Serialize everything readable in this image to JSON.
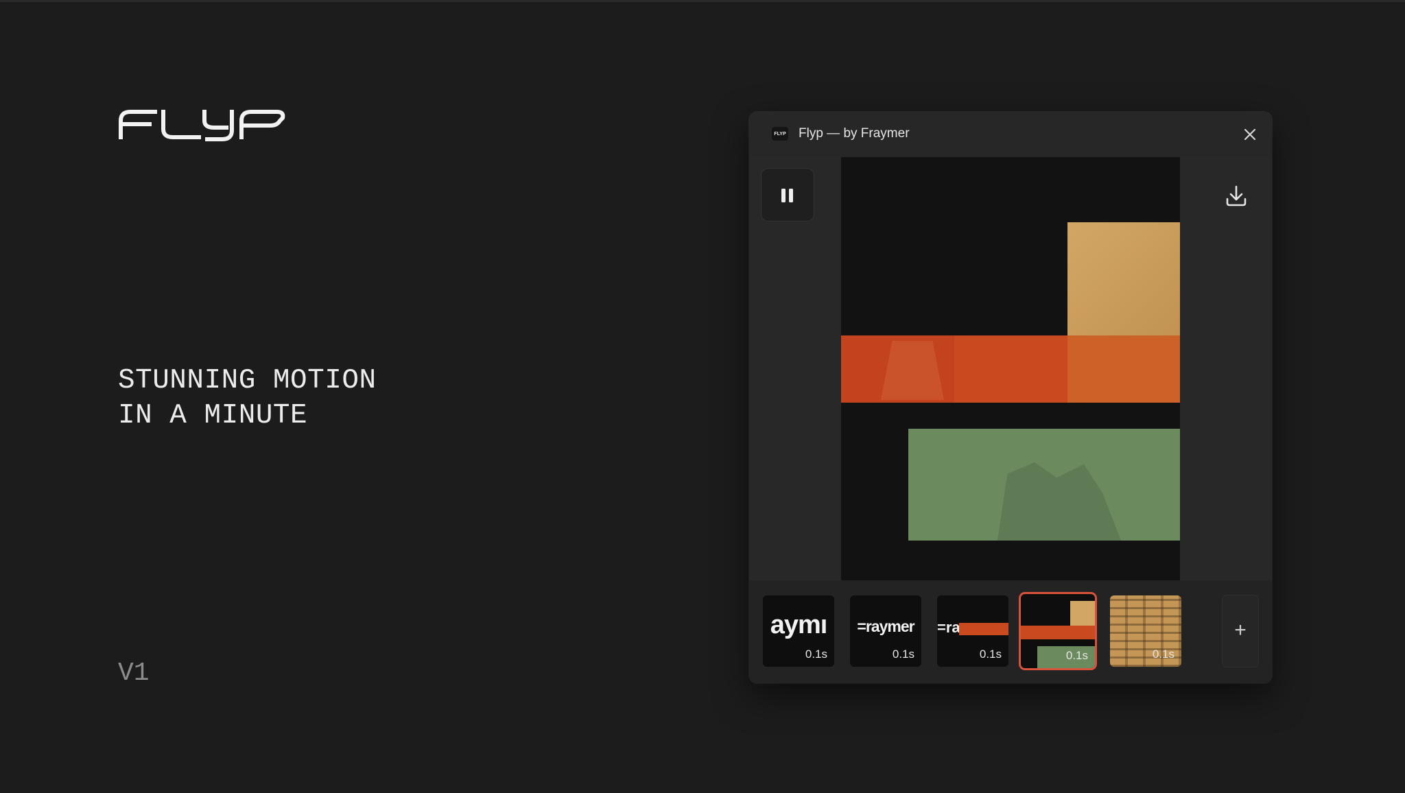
{
  "brand": {
    "logo_text": "FLYP"
  },
  "hero": {
    "line1": "STUNNING MOTION",
    "line2": "IN A MINUTE"
  },
  "version": "V1",
  "window": {
    "app_icon_text": "FLYP",
    "title": "Flyp — by Fraymer",
    "controls": {
      "pause_icon": "pause-icon",
      "download_icon": "download-icon",
      "close_icon": "close-icon",
      "add_icon": "plus-icon"
    },
    "add_label": "+"
  },
  "colors": {
    "background": "#1c1c1c",
    "window": "#262626",
    "canvas": "#121212",
    "tan": "#c79a55",
    "orange": "#c4501f",
    "green": "#6b8a5e",
    "selected_outline": "#d9533a"
  },
  "frames": [
    {
      "text": "aymı",
      "duration": "0.1s",
      "selected": false
    },
    {
      "text": "=raymer",
      "duration": "0.1s",
      "selected": false
    },
    {
      "text": "=ra",
      "duration": "0.1s",
      "selected": false
    },
    {
      "text": "",
      "duration": "0.1s",
      "selected": true
    },
    {
      "text": "",
      "duration": "0.1s",
      "selected": false
    }
  ]
}
